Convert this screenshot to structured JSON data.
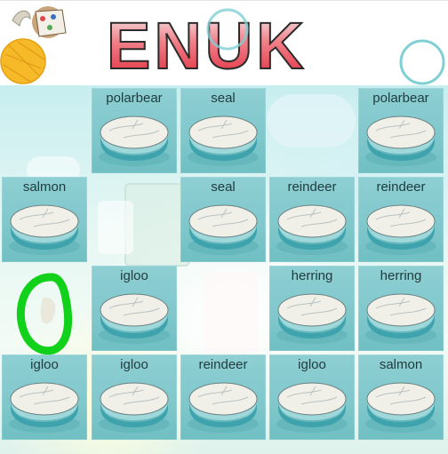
{
  "header": {
    "logo_text": "ENUK"
  },
  "board": {
    "tiles": [
      {
        "label": "polarbear"
      },
      {
        "label": "seal"
      },
      {
        "label": "polarbear"
      },
      {
        "label": "salmon"
      },
      {
        "label": "seal"
      },
      {
        "label": "reindeer"
      },
      {
        "label": "reindeer"
      },
      {
        "label": "igloo"
      },
      {
        "label": "herring"
      },
      {
        "label": "herring"
      },
      {
        "label": "igloo"
      },
      {
        "label": "igloo"
      },
      {
        "label": "reindeer"
      },
      {
        "label": "igloo"
      },
      {
        "label": "salmon"
      }
    ]
  },
  "colors": {
    "tile": "#7fc7cb",
    "logo_red": "#e8313f",
    "ring": "#7fd0d4",
    "cursor_green": "#11d11a"
  }
}
